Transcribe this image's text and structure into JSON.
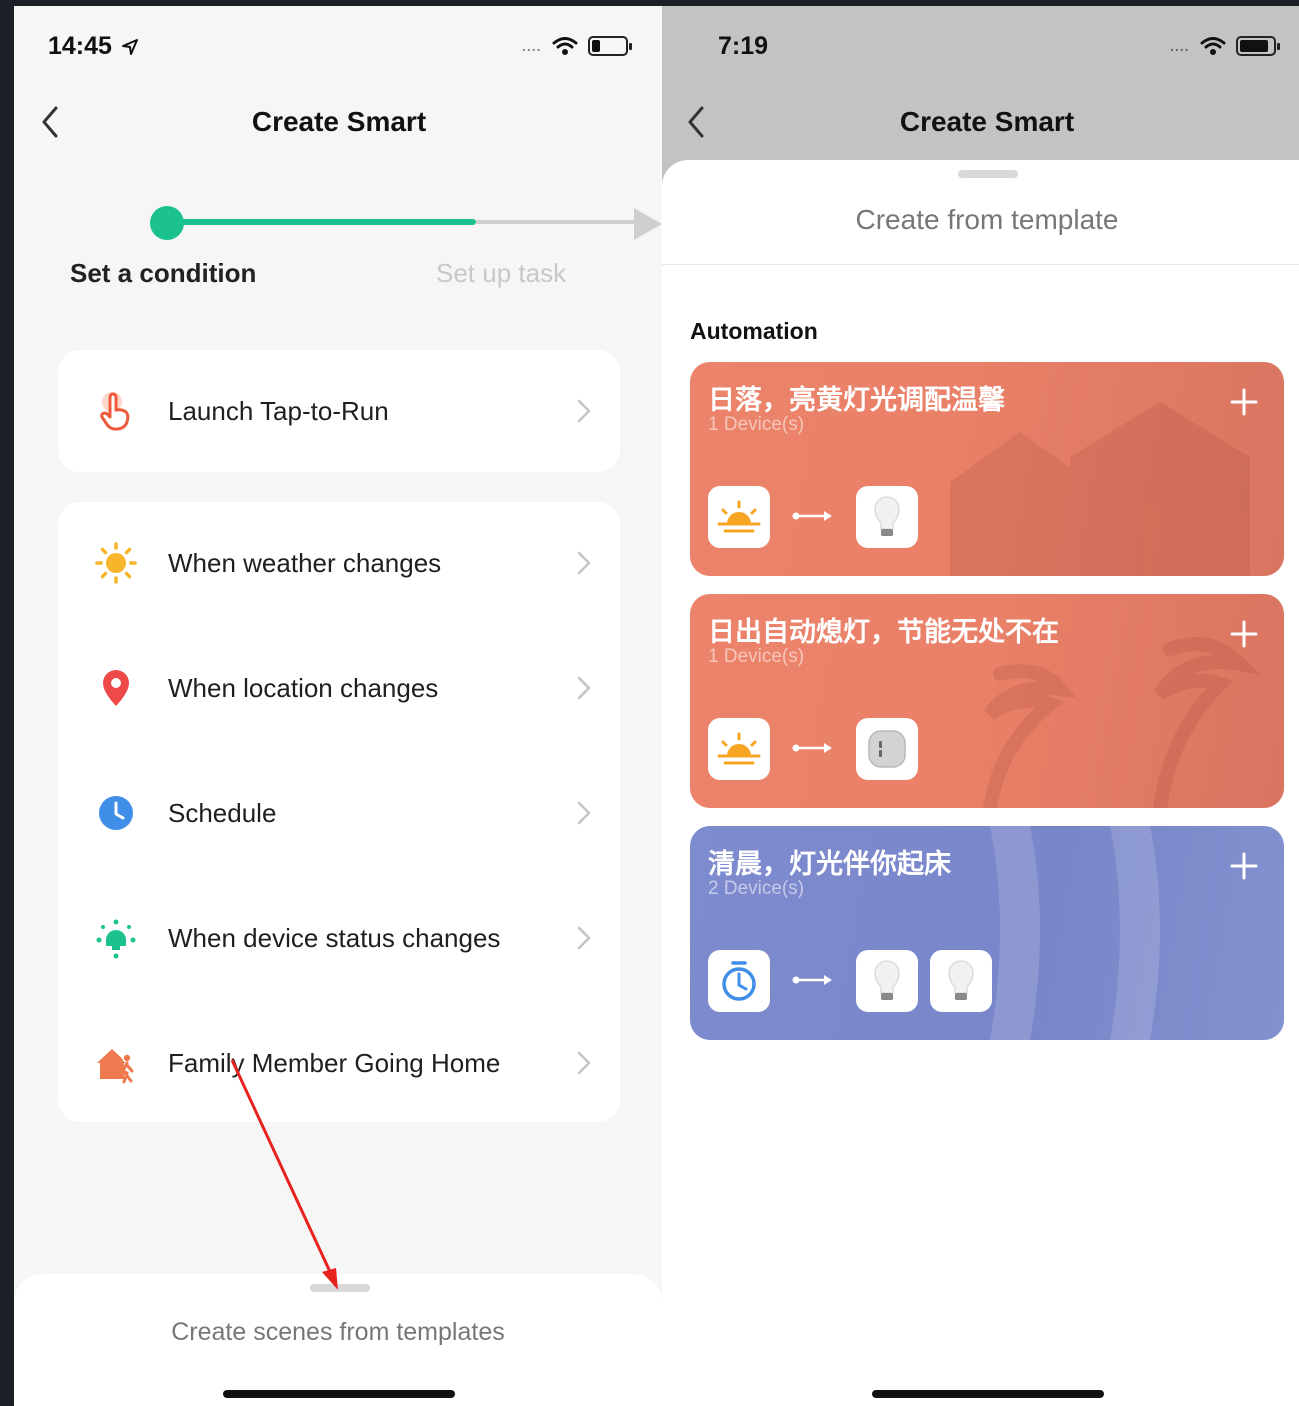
{
  "left_screen": {
    "status": {
      "time": "14:45",
      "signal_dots": "....",
      "battery_level": 0.25
    },
    "nav": {
      "title": "Create Smart"
    },
    "stepper": {
      "step1": "Set a condition",
      "step2": "Set up task"
    },
    "launch": {
      "label": "Launch Tap-to-Run"
    },
    "conditions": [
      {
        "label": "When weather changes",
        "icon": "sun-icon"
      },
      {
        "label": "When location changes",
        "icon": "location-pin-icon"
      },
      {
        "label": "Schedule",
        "icon": "clock-icon"
      },
      {
        "label": "When device status changes",
        "icon": "device-icon"
      },
      {
        "label": "Family Member Going Home",
        "icon": "family-home-icon"
      }
    ],
    "bottom_sheet": {
      "label": "Create scenes from templates"
    },
    "colors": {
      "accent": "#1bc28f",
      "annotation_arrow": "#e8231f"
    }
  },
  "right_screen": {
    "status": {
      "time": "7:19",
      "signal_dots": "....",
      "battery_level": 0.9
    },
    "nav": {
      "title": "Create Smart"
    },
    "sheet": {
      "title": "Create from template",
      "section": "Automation"
    },
    "templates": [
      {
        "title": "日落，亮黄灯光调配温馨",
        "devices": "1 Device(s)",
        "color": "#e9806a",
        "trigger_icon": "sunset-icon",
        "target_icons": [
          "bulb-icon"
        ]
      },
      {
        "title": "日出自动熄灯，节能无处不在",
        "devices": "1 Device(s)",
        "color": "#e9806a",
        "trigger_icon": "sunrise-icon",
        "target_icons": [
          "smart-plug-icon"
        ]
      },
      {
        "title": "清晨，灯光伴你起床",
        "devices": "2 Device(s)",
        "color": "#7b88cb",
        "trigger_icon": "timer-icon",
        "target_icons": [
          "bulb-icon",
          "bulb-icon"
        ]
      }
    ]
  }
}
